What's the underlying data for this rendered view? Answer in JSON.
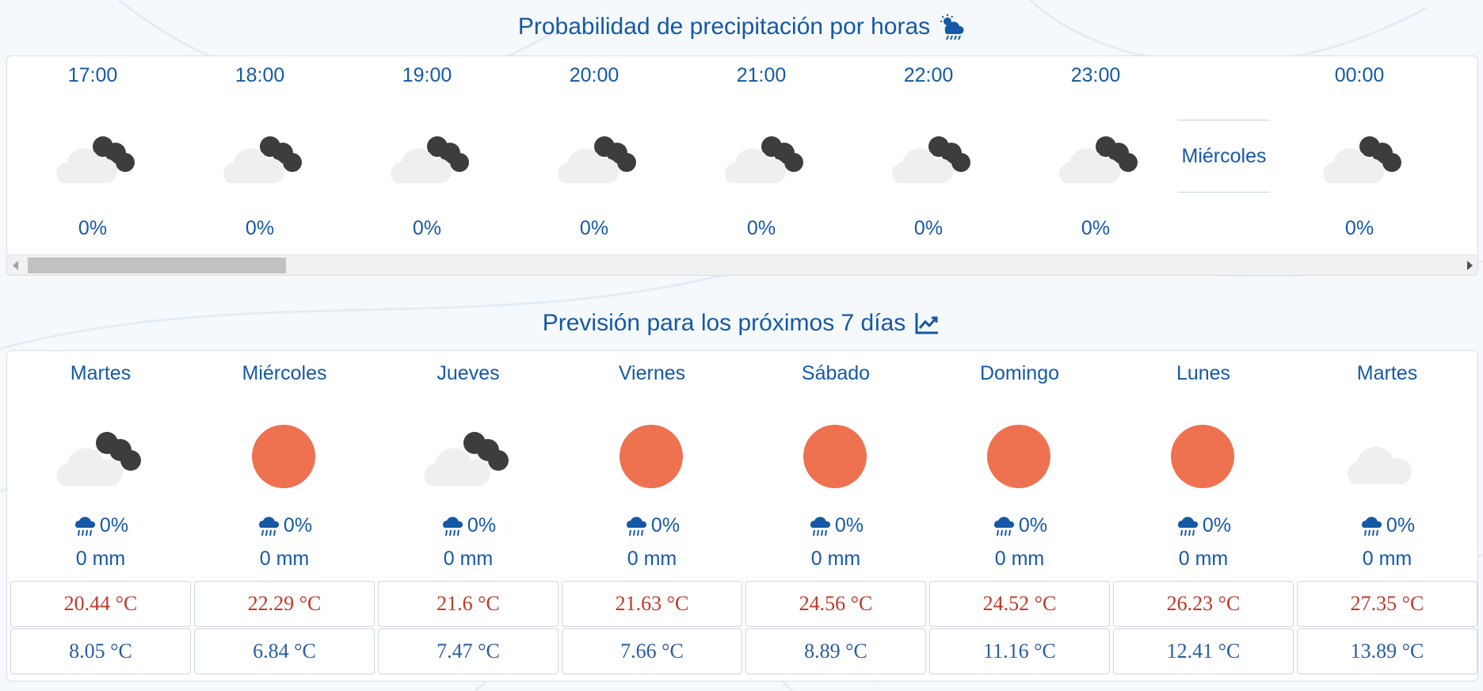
{
  "hourly": {
    "title": "Probabilidad de precipitación por horas",
    "title_icon": "cloud-sun-rain-icon",
    "hours": [
      {
        "time": "17:00",
        "icon": "cloud-night-icon",
        "pct": "0%"
      },
      {
        "time": "18:00",
        "icon": "cloud-night-icon",
        "pct": "0%"
      },
      {
        "time": "19:00",
        "icon": "cloud-night-icon",
        "pct": "0%"
      },
      {
        "time": "20:00",
        "icon": "cloud-night-icon",
        "pct": "0%"
      },
      {
        "time": "21:00",
        "icon": "cloud-night-icon",
        "pct": "0%"
      },
      {
        "time": "22:00",
        "icon": "cloud-night-icon",
        "pct": "0%"
      },
      {
        "time": "23:00",
        "icon": "cloud-night-icon",
        "pct": "0%"
      },
      {
        "time": "00:00",
        "icon": "cloud-night-icon",
        "pct": "0%"
      }
    ],
    "day_divider": "Miércoles"
  },
  "daily": {
    "title": "Previsión para los próximos 7 días",
    "title_icon": "trend-chart-icon",
    "days": [
      {
        "name": "Martes",
        "icon": "cloud-night-icon",
        "rain_pct": "0%",
        "rain_mm": "0 mm",
        "max": "20.44 °C",
        "min": "8.05 °C"
      },
      {
        "name": "Miércoles",
        "icon": "sun-icon",
        "rain_pct": "0%",
        "rain_mm": "0 mm",
        "max": "22.29 °C",
        "min": "6.84 °C"
      },
      {
        "name": "Jueves",
        "icon": "cloud-night-icon",
        "rain_pct": "0%",
        "rain_mm": "0 mm",
        "max": "21.6 °C",
        "min": "7.47 °C"
      },
      {
        "name": "Viernes",
        "icon": "sun-icon",
        "rain_pct": "0%",
        "rain_mm": "0 mm",
        "max": "21.63 °C",
        "min": "7.66 °C"
      },
      {
        "name": "Sábado",
        "icon": "sun-icon",
        "rain_pct": "0%",
        "rain_mm": "0 mm",
        "max": "24.56 °C",
        "min": "8.89 °C"
      },
      {
        "name": "Domingo",
        "icon": "sun-icon",
        "rain_pct": "0%",
        "rain_mm": "0 mm",
        "max": "24.52 °C",
        "min": "11.16 °C"
      },
      {
        "name": "Lunes",
        "icon": "sun-icon",
        "rain_pct": "0%",
        "rain_mm": "0 mm",
        "max": "26.23 °C",
        "min": "12.41 °C"
      },
      {
        "name": "Martes",
        "icon": "cloud-icon",
        "rain_pct": "0%",
        "rain_mm": "0 mm",
        "max": "27.35 °C",
        "min": "13.89 °C"
      }
    ]
  },
  "colors": {
    "accent": "#1559a6",
    "sun": "#ee7150",
    "cloud": "#efefef",
    "night_cloud": "#3d3d3d",
    "max_temp": "#c0392b",
    "min_temp": "#2a5d9f"
  }
}
